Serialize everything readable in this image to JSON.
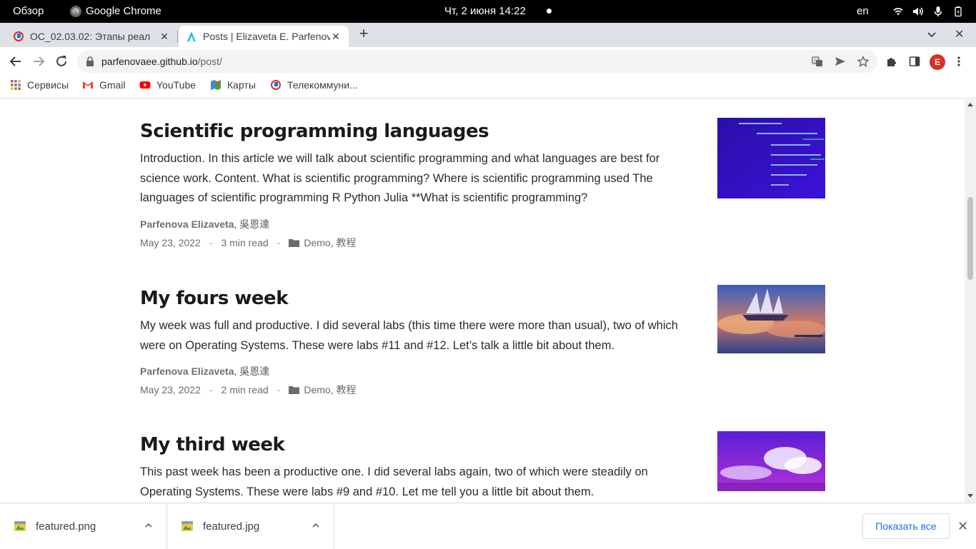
{
  "topbar": {
    "overview": "Обзор",
    "app_name": "Google Chrome",
    "clock": "Чт, 2 июня  14:22",
    "lang": "en"
  },
  "tabs": [
    {
      "title": "ОС_02.03.02: Этапы реал",
      "active": false
    },
    {
      "title": "Posts | Elizaveta E. Parfenova",
      "active": true
    }
  ],
  "toolbar": {
    "url_host": "parfenovaee.github.io",
    "url_path": "/post/",
    "profile_initial": "E"
  },
  "bookmarks": [
    {
      "label": "Сервисы",
      "icon": "apps-grid-icon"
    },
    {
      "label": "Gmail",
      "icon": "gmail-icon"
    },
    {
      "label": "YouTube",
      "icon": "youtube-icon"
    },
    {
      "label": "Карты",
      "icon": "maps-icon"
    },
    {
      "label": "Телекоммуни...",
      "icon": "telecom-icon"
    }
  ],
  "posts": [
    {
      "title": "Scientific programming languages",
      "summary": "Introduction. In this article we will talk about scientific programming and what languages are best for science work. Content. What is scientific programming? Where is scientific programming used The languages of scientific programming R Python Julia **What is scientific programming?",
      "author_main": "Parfenova Elizaveta",
      "author_other": ", 吳恩達",
      "date": "May 23, 2022",
      "read_time": "3 min read",
      "categories": "Demo, 教程"
    },
    {
      "title": "My fours week",
      "summary": "My week was full and productive. I did several labs (this time there were more than usual), two of which were on Operating Systems. These were labs #11 and #12. Let’s talk a little bit about them.",
      "author_main": "Parfenova Elizaveta",
      "author_other": ", 吳恩達",
      "date": "May 23, 2022",
      "read_time": "2 min read",
      "categories": "Demo, 教程"
    },
    {
      "title": "My third week",
      "summary": "This past week has been a productive one. I did several labs again, two of which were steadily on Operating Systems. These were labs #9 and #10. Let me tell you a little bit about them."
    }
  ],
  "meta_sep": "·",
  "downloads": [
    {
      "filename": "featured.png"
    },
    {
      "filename": "featured.jpg"
    }
  ],
  "shelf": {
    "show_all": "Показать все"
  },
  "colors": {
    "chrome_tabstrip": "#dee1e6",
    "link_blue": "#1a73e8",
    "profile_red": "#d93025"
  }
}
